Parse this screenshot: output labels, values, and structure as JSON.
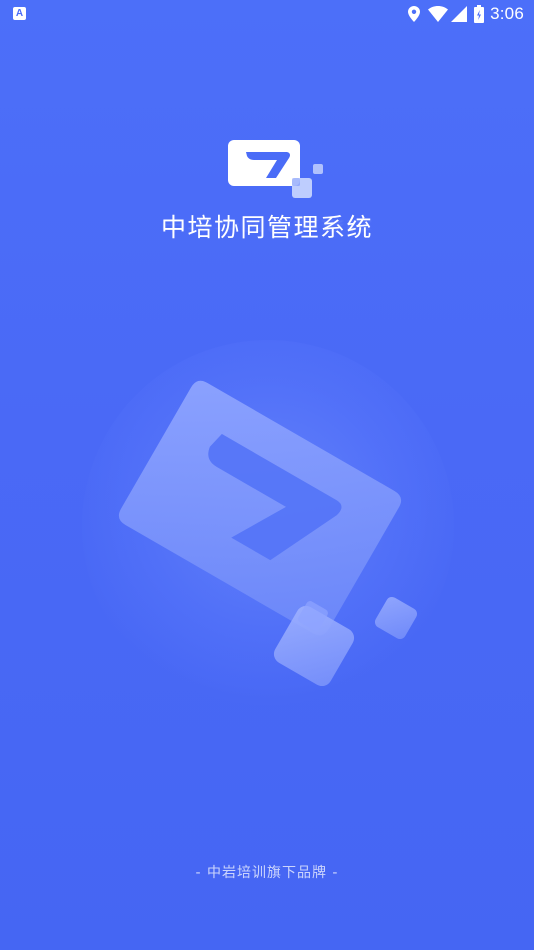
{
  "status_bar": {
    "app_icon_letter": "A",
    "time": "3:06",
    "icons": [
      "location-icon",
      "wifi-icon",
      "signal-icon",
      "battery-icon"
    ]
  },
  "splash": {
    "title": "中培协同管理系统",
    "footer": "- 中岩培训旗下品牌 -",
    "logo_icon": "company-logo-icon",
    "illustration_icon": "logo-illustration-icon"
  },
  "colors": {
    "background": "#4a6cf7",
    "text": "#ffffff"
  }
}
